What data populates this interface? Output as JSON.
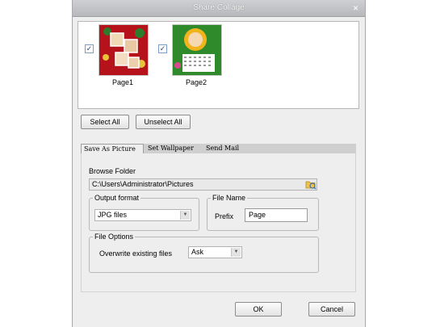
{
  "window": {
    "title": "Share Collage",
    "close_glyph": "×"
  },
  "pages": [
    {
      "label": "Page1",
      "checked": true,
      "check_glyph": "✓"
    },
    {
      "label": "Page2",
      "checked": true,
      "check_glyph": "✓"
    }
  ],
  "selection": {
    "select_all": "Select All",
    "unselect_all": "Unselect All"
  },
  "tabs": [
    {
      "label": "Save As Picture",
      "active": true
    },
    {
      "label": "Set Wallpaper",
      "active": false
    },
    {
      "label": "Send Mail",
      "active": false
    }
  ],
  "save_as": {
    "browse_label": "Browse Folder",
    "folder_path": "C:\\Users\\Administrator\\Pictures",
    "output_format": {
      "legend": "Output format",
      "value": "JPG files"
    },
    "file_name": {
      "legend": "File Name",
      "prefix_label": "Prefix",
      "prefix_value": "Page"
    },
    "file_options": {
      "legend": "File Options",
      "overwrite_label": "Overwrite existing files",
      "overwrite_value": "Ask"
    }
  },
  "footer": {
    "ok": "OK",
    "cancel": "Cancel"
  },
  "colors": {
    "title_bar": "#c3c5c8",
    "dialog_bg": "#eeeeee",
    "thumb1_bg": "#b5121b",
    "thumb2_bg": "#2f8a2c"
  },
  "icons": {
    "close": "close-icon",
    "folder": "folder-browse-icon",
    "dropdown": "chevron-down-icon",
    "check": "check-icon"
  }
}
